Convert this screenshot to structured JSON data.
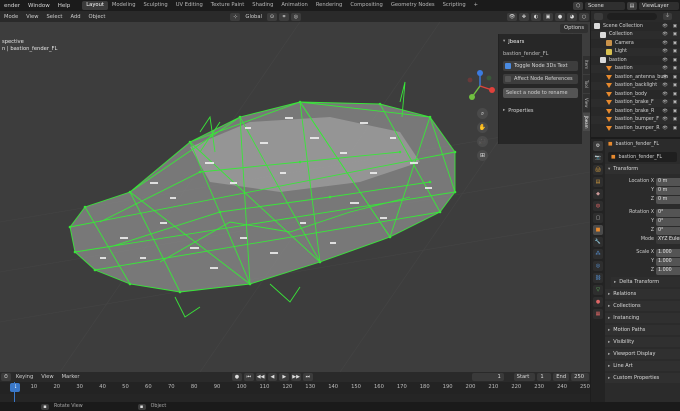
{
  "topbar": {
    "menus": [
      "ender",
      "Window",
      "Help"
    ],
    "workspaces": [
      "Layout",
      "Modeling",
      "Sculpting",
      "UV Editing",
      "Texture Paint",
      "Shading",
      "Animation",
      "Rendering",
      "Compositing",
      "Geometry Nodes",
      "Scripting"
    ],
    "active_workspace": "Layout",
    "scene_label": "Scene",
    "view_layer_label": "ViewLayer"
  },
  "viewport_header": {
    "mode": "Mode",
    "menus": [
      "View",
      "Select",
      "Add",
      "Object"
    ],
    "transform_orientation": "Global",
    "options_label": "Options"
  },
  "viewport": {
    "view_label": "spective",
    "object_label": "n | bastion_fender_FL"
  },
  "npanel": {
    "header": "Jbears",
    "object_name": "bastion_fender_FL",
    "toggle_text_label": "Toggle Node 3Ds Text",
    "toggle_text_checked": true,
    "affect_refs_label": "Affect Node References",
    "affect_refs_checked": false,
    "rename_placeholder": "Select a node to rename",
    "properties_label": "Properties",
    "tabs": [
      "Item",
      "Tool",
      "View",
      "Jbeam"
    ]
  },
  "outliner": {
    "items": [
      {
        "label": "Scene Collection",
        "icon": "scene-collection-icon",
        "indent": 0
      },
      {
        "label": "Collection",
        "icon": "collection-icon",
        "indent": 1
      },
      {
        "label": "Camera",
        "icon": "camera-icon",
        "indent": 2
      },
      {
        "label": "Light",
        "icon": "light-icon",
        "indent": 2
      },
      {
        "label": "bastion",
        "icon": "collection-icon",
        "indent": 1
      },
      {
        "label": "bastion",
        "icon": "mesh-icon",
        "indent": 2
      },
      {
        "label": "bastion_antenna_bum",
        "icon": "mesh-icon",
        "indent": 2
      },
      {
        "label": "bastion_backlight",
        "icon": "mesh-icon",
        "indent": 2
      },
      {
        "label": "bastion_body",
        "icon": "mesh-icon",
        "indent": 2
      },
      {
        "label": "bastion_brake_F",
        "icon": "mesh-icon",
        "indent": 2
      },
      {
        "label": "bastion_brake_R",
        "icon": "mesh-icon",
        "indent": 2
      },
      {
        "label": "bastion_bumper_F",
        "icon": "mesh-icon",
        "indent": 2
      },
      {
        "label": "bastion_bumper_R",
        "icon": "mesh-icon",
        "indent": 2
      }
    ]
  },
  "properties": {
    "breadcrumb": "bastion_fender_FL",
    "name_field": "bastion_fender_FL",
    "transform_label": "Transform",
    "location_x_label": "Location X",
    "y_label": "Y",
    "z_label": "Z",
    "rotation_x_label": "Rotation X",
    "mode_label": "Mode",
    "mode_value": "XYZ Euler",
    "scale_x_label": "Scale X",
    "location_values": [
      "0 m",
      "0 m",
      "0 m"
    ],
    "rotation_values": [
      "0°",
      "0°",
      "0°"
    ],
    "scale_values": [
      "1.000",
      "1.000",
      "1.000"
    ],
    "sections": [
      "Delta Transform",
      "Relations",
      "Collections",
      "Instancing",
      "Motion Paths",
      "Visibility",
      "Viewport Display",
      "Line Art",
      "Custom Properties"
    ]
  },
  "timeline": {
    "menus": [
      "Keying",
      "View",
      "Marker"
    ],
    "current_frame": "1",
    "start_label": "Start",
    "start_value": "1",
    "end_label": "End",
    "end_value": "250",
    "frame_marks": [
      "1",
      "10",
      "20",
      "30",
      "40",
      "50",
      "60",
      "70",
      "80",
      "90",
      "100",
      "110",
      "120",
      "130",
      "140",
      "150",
      "160",
      "170",
      "180",
      "190",
      "200",
      "210",
      "220",
      "230",
      "240",
      "250"
    ]
  },
  "status": {
    "rotate_view": "Rotate View",
    "object": "Object"
  },
  "colors": {
    "accent": "#3a78c9",
    "wire": "#39e639",
    "mesh_orange": "#e88a2e",
    "viewport_bg": "#3d3d3d"
  }
}
